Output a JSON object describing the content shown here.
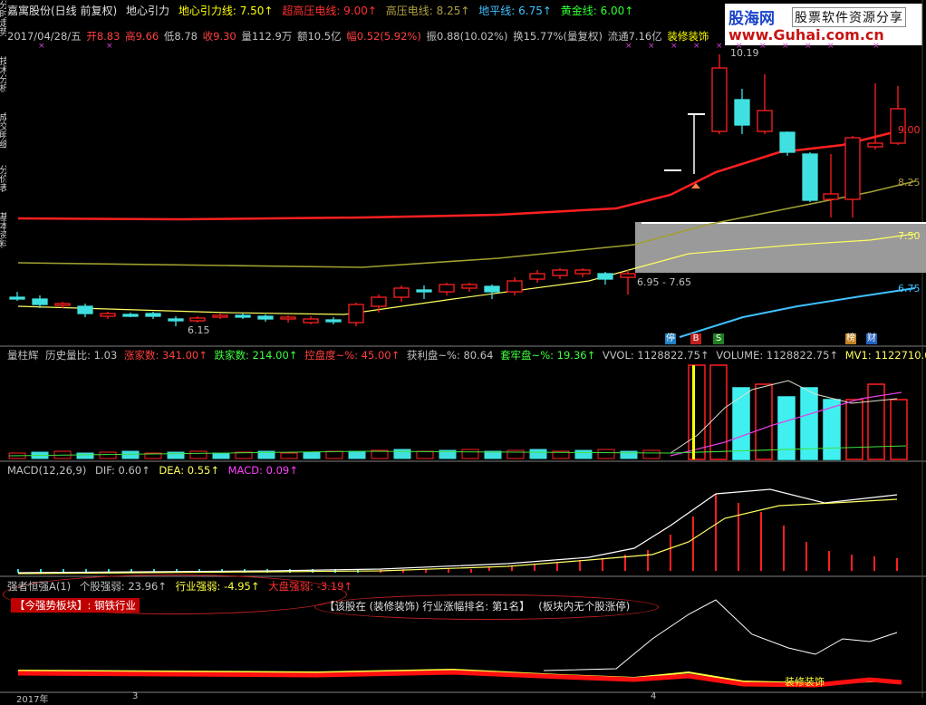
{
  "header": {
    "stock": "嘉寓股份(日线 前复权)",
    "indicator": "地心引力",
    "lines": [
      {
        "label": "地心引力线: 7.50↑",
        "color": "#ffff00"
      },
      {
        "label": "超高压电线: 9.00↑",
        "color": "#ff3030"
      },
      {
        "label": "高压电线: 8.25↑",
        "color": "#b0a040"
      },
      {
        "label": "地平线: 6.75↑",
        "color": "#40c0ff"
      },
      {
        "label": "黄金线: 6.00↑",
        "color": "#30ff30"
      }
    ]
  },
  "info": {
    "date": "2017/04/28/五",
    "open": "开8.83",
    "high": "高9.66",
    "low": "低8.78",
    "close": "收9.30",
    "volume": "量112.9万",
    "amount": "额10.5亿",
    "change": "幅0.52(5.92%)",
    "amplitude": "振0.88(10.02%)",
    "turnover": "换15.77%(量复权)",
    "float": "流通7.16亿",
    "sector": "装修装饰"
  },
  "logo": {
    "brand": "股海网",
    "tag": "股票软件资源分享",
    "url": "www.Guhai.com.cn"
  },
  "price_labels": {
    "high": "10.19",
    "low": "6.15",
    "range": "6.95 - 7.65",
    "l900": "9.00",
    "l825": "8.25",
    "l750": "7.50",
    "l675": "6.75"
  },
  "signals": {
    "stop": "停",
    "buy": "B",
    "sell": "S",
    "rank": "榜",
    "fin": "财"
  },
  "vol_panel": {
    "name": "量柱辉",
    "hist": "历史量比: 1.03",
    "up": "涨家数: 341.00↑",
    "down": "跌家数: 214.00↑",
    "control": "控盘度~%: 45.00↑",
    "profit": "获利盘~%: 80.64",
    "trapped": "套牢盘~%: 19.36↑",
    "vol": "VVOL: 1128822.75↑",
    "volume": "VOLUME: 1128822.75↑",
    "mv1": "MV1: 1122710.00"
  },
  "macd_panel": {
    "name": "MACD(12,26,9)",
    "dif": "DIF: 0.60↑",
    "dea": "DEA: 0.55↑",
    "macd": "MACD: 0.09↑"
  },
  "strength_panel": {
    "name": "强者恒强A(1)",
    "stock": "个股强弱: 23.96↑",
    "industry": "行业强弱: -4.95↑",
    "market": "大盘强弱: -3.19↑",
    "today": "【今强势板块】: 钢铁行业",
    "rank": "【该股在 (装修装饰) 行业涨幅排名: 第1名】",
    "limit": "(板块内无个股涨停)",
    "sector_tag": "装修装饰"
  },
  "axis": {
    "year": "2017年",
    "m3": "3",
    "m4": "4"
  },
  "side_tabs": [
    "分时走势",
    "技术分析",
    "成交明细",
    "分价表",
    "基本资料"
  ]
}
